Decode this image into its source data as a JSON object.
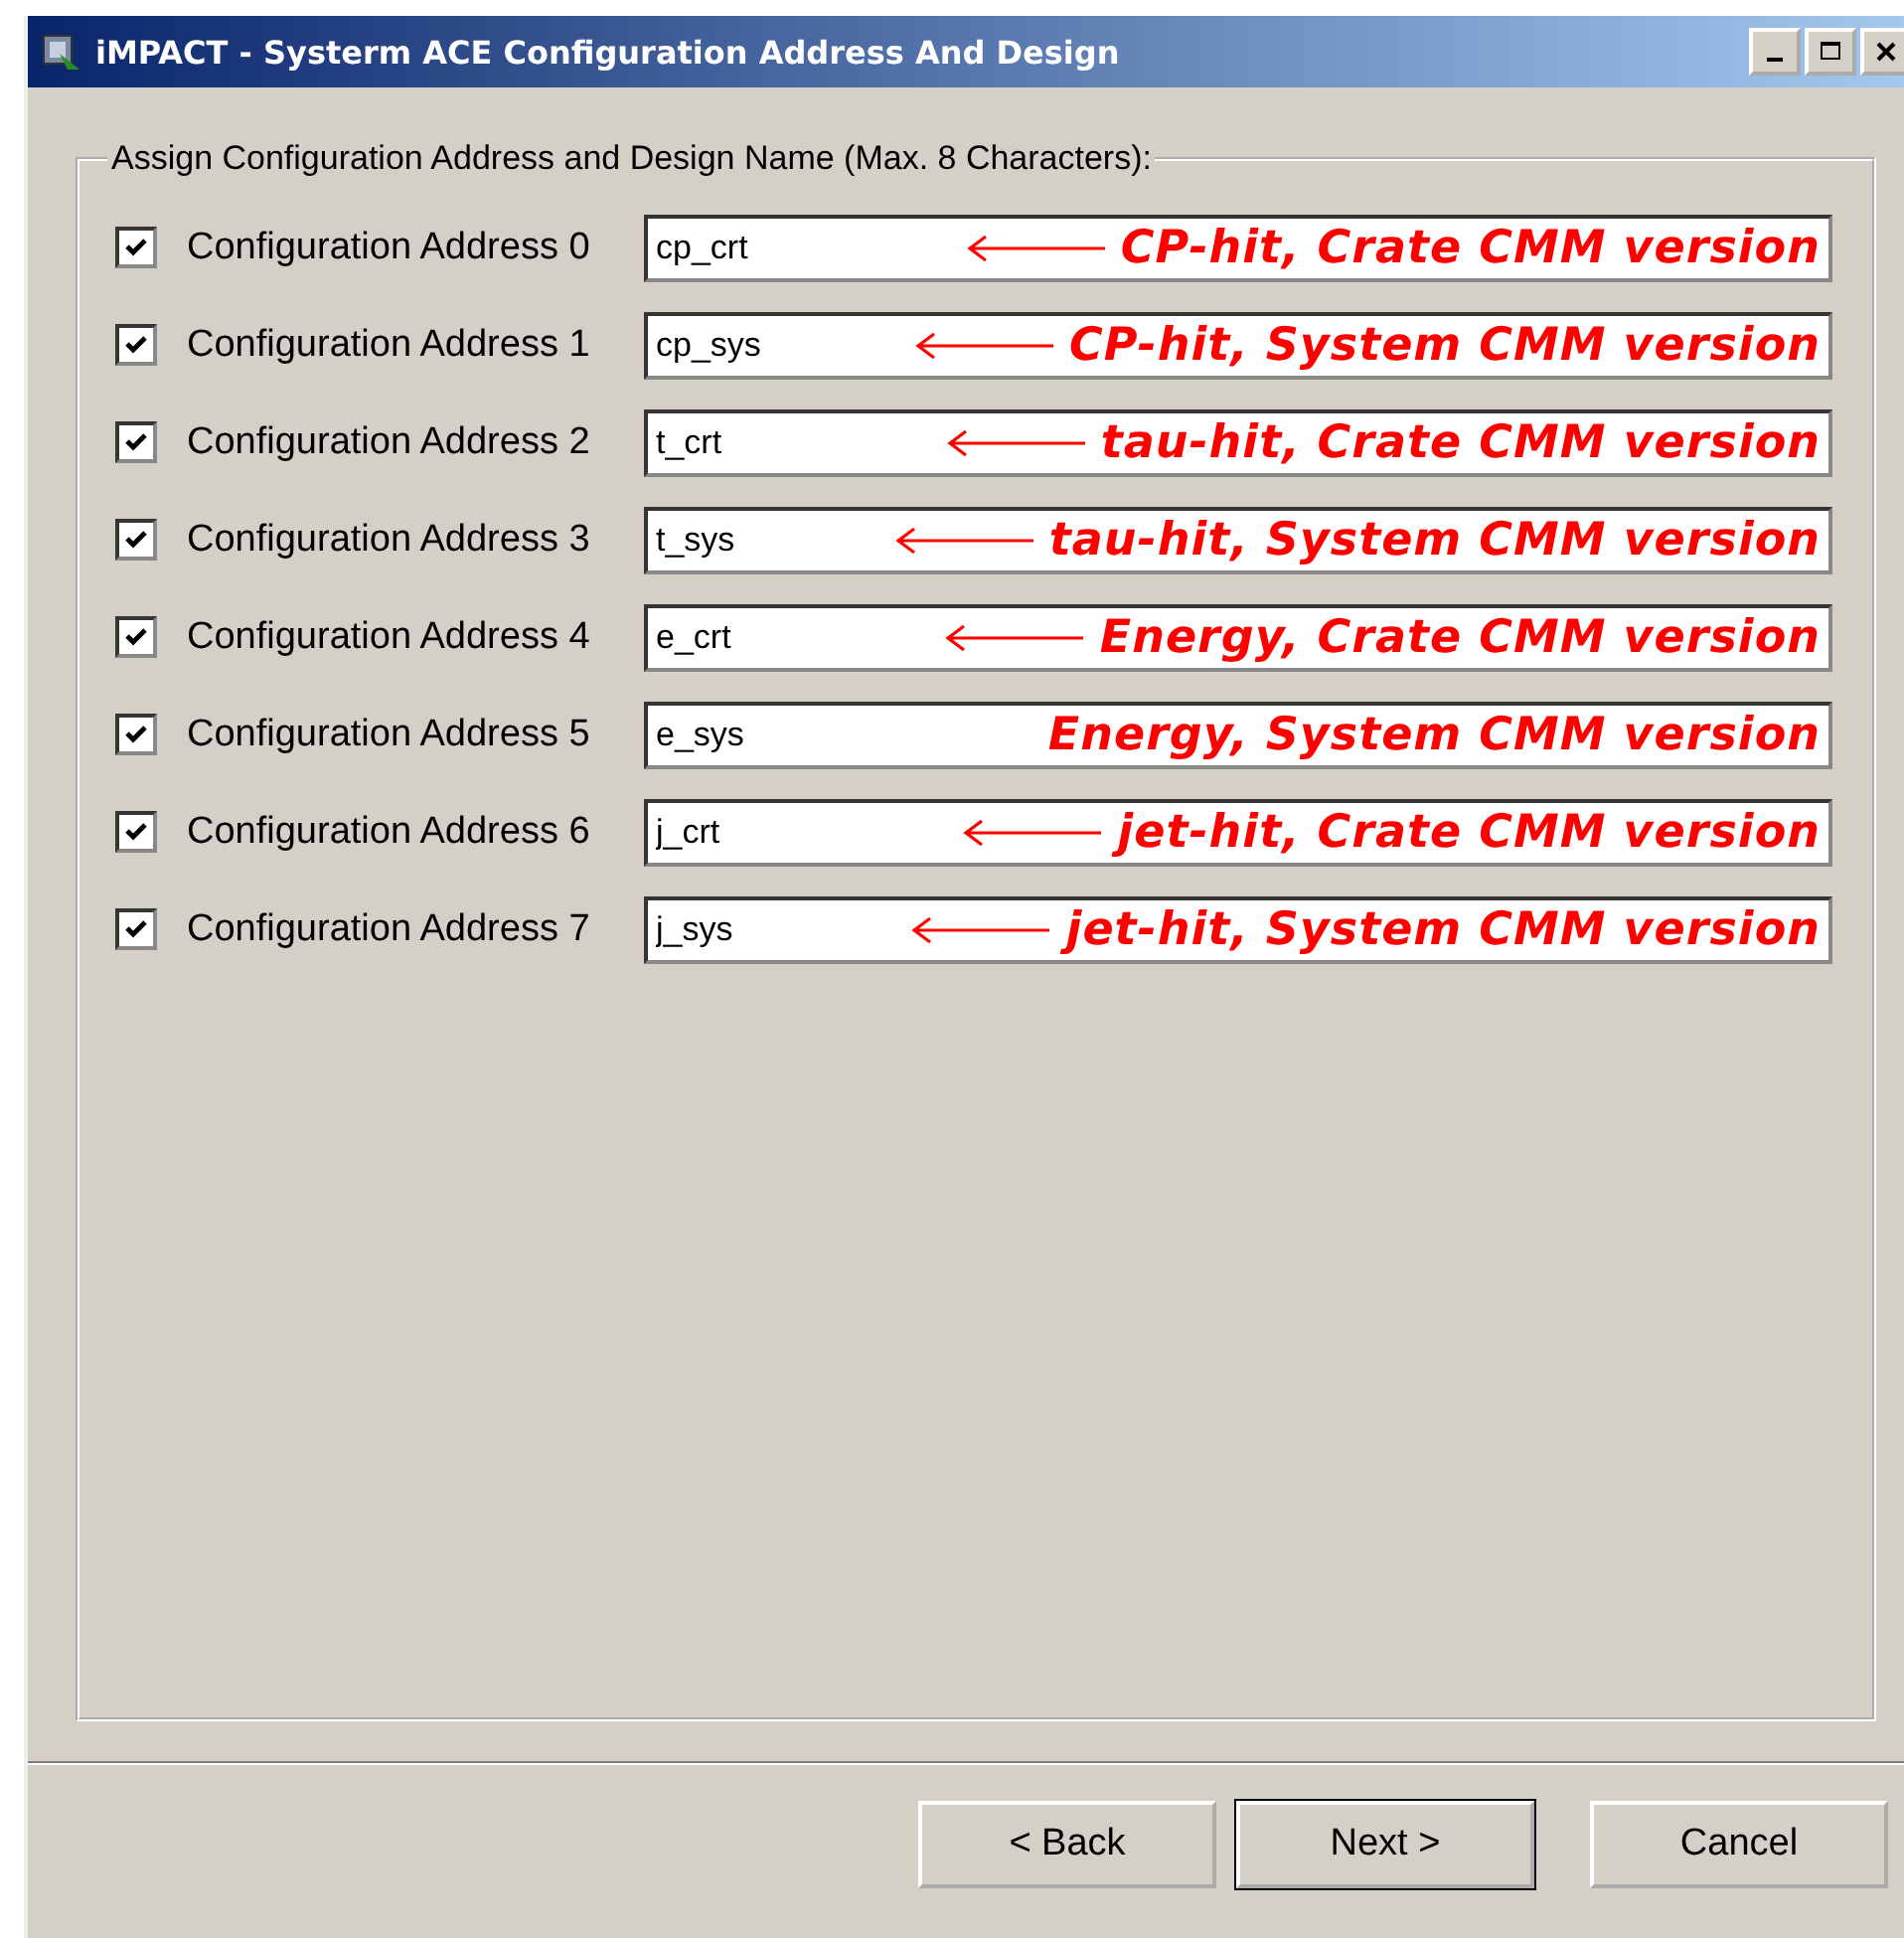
{
  "window": {
    "title": "iMPACT - Systerm ACE Configuration Address And Design"
  },
  "group": {
    "legend": "Assign Configuration Address and Design Name (Max. 8 Characters):"
  },
  "rows": [
    {
      "label": "Configuration Address 0",
      "checked": true,
      "value": "cp_crt",
      "annotation": "CP-hit, Crate CMM version",
      "arrow": true
    },
    {
      "label": "Configuration Address 1",
      "checked": true,
      "value": "cp_sys",
      "annotation": "CP-hit, System CMM version",
      "arrow": true
    },
    {
      "label": "Configuration Address 2",
      "checked": true,
      "value": "t_crt",
      "annotation": "tau-hit, Crate CMM version",
      "arrow": true
    },
    {
      "label": "Configuration Address 3",
      "checked": true,
      "value": "t_sys",
      "annotation": "tau-hit, System CMM version",
      "arrow": true
    },
    {
      "label": "Configuration Address 4",
      "checked": true,
      "value": "e_crt",
      "annotation": "Energy, Crate CMM version",
      "arrow": true
    },
    {
      "label": "Configuration Address 5",
      "checked": true,
      "value": "e_sys",
      "annotation": "Energy, System CMM version",
      "arrow": false
    },
    {
      "label": "Configuration Address 6",
      "checked": true,
      "value": "j_crt",
      "annotation": "jet-hit, Crate CMM version",
      "arrow": true
    },
    {
      "label": "Configuration Address 7",
      "checked": true,
      "value": "j_sys",
      "annotation": "jet-hit, System CMM version",
      "arrow": true
    }
  ],
  "buttons": [
    {
      "label": "< Back",
      "default": false
    },
    {
      "label": "Next >",
      "default": true
    },
    {
      "label": "Cancel",
      "default": false
    }
  ]
}
